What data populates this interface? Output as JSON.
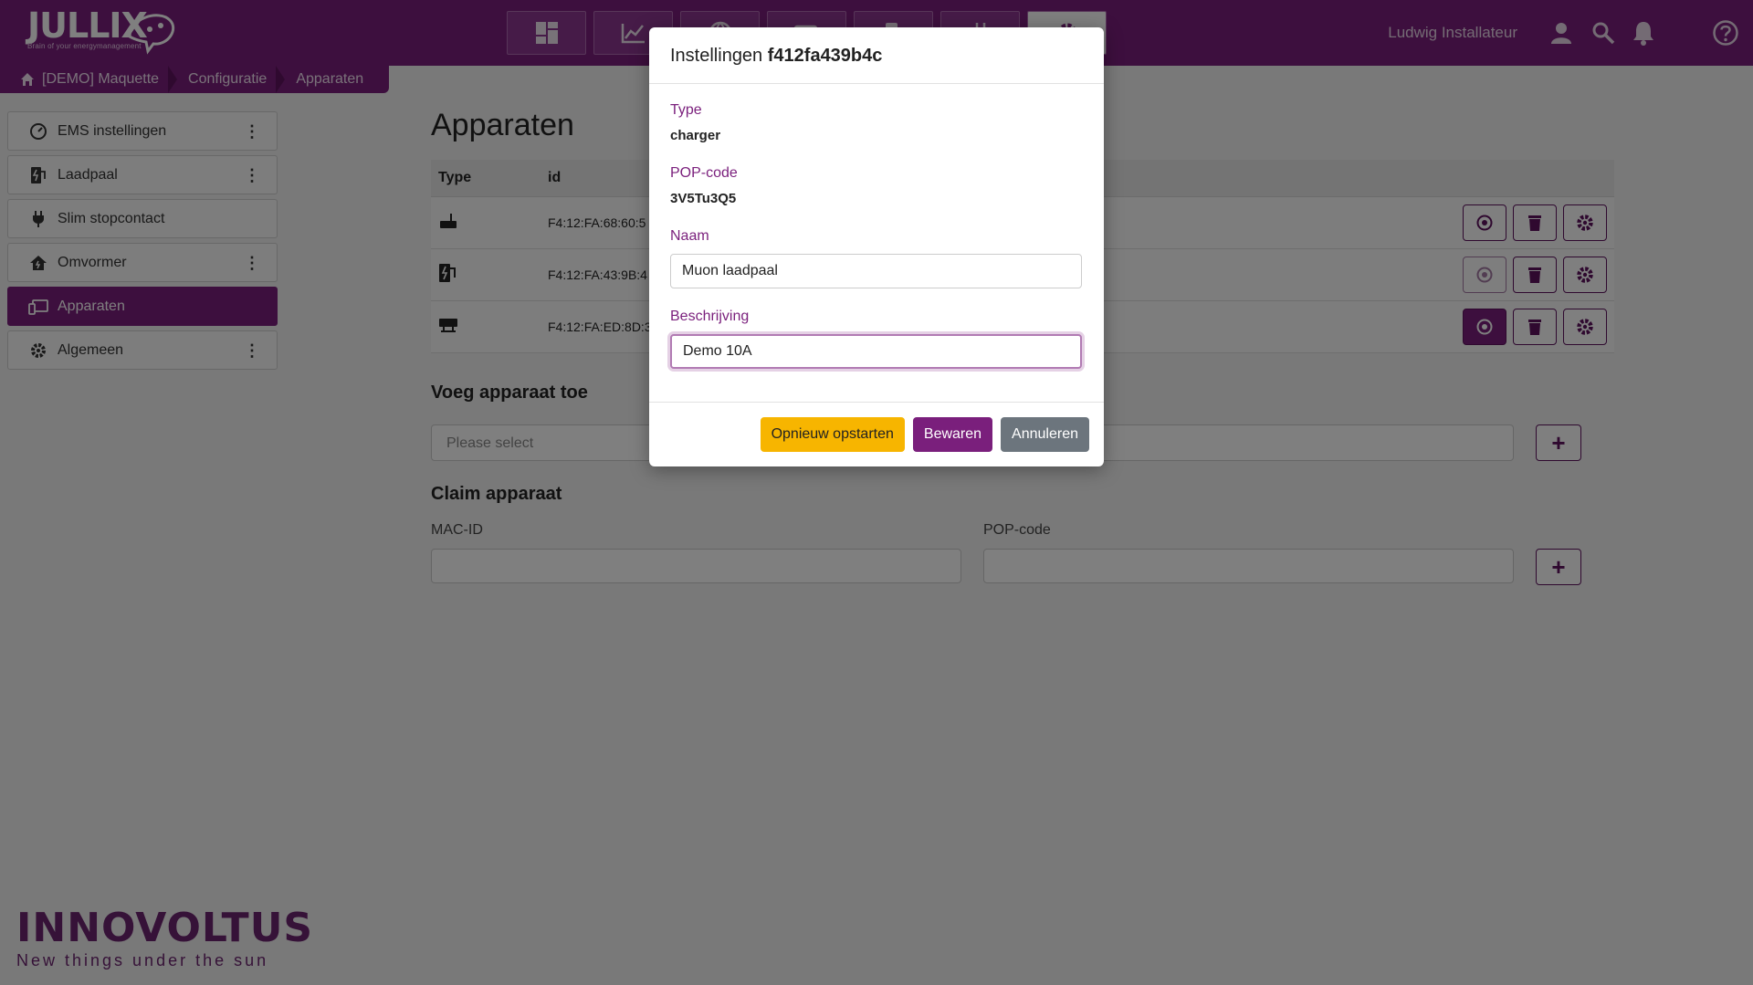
{
  "header": {
    "logo_text": "JULLIX",
    "logo_tagline": "Brain of your energymanagement",
    "user_name": "Ludwig Installateur",
    "nav_tabs": [
      {
        "icon": "dashboard-icon"
      },
      {
        "icon": "chart-icon"
      },
      {
        "icon": "globe-icon"
      },
      {
        "icon": "battery-icon"
      },
      {
        "icon": "charger-icon"
      },
      {
        "icon": "plug-icon"
      },
      {
        "icon": "gear-icon",
        "active": true
      }
    ]
  },
  "breadcrumb": {
    "items": [
      "[DEMO] Maquette",
      "Configuratie",
      "Apparaten"
    ]
  },
  "sidebar": {
    "items": [
      {
        "label": "EMS instellingen",
        "icon": "gauge-icon",
        "has_menu": true
      },
      {
        "label": "Laadpaal",
        "icon": "charger-icon",
        "has_menu": true
      },
      {
        "label": "Slim stopcontact",
        "icon": "plug-icon",
        "has_menu": false
      },
      {
        "label": "Omvormer",
        "icon": "house-icon",
        "has_menu": true
      },
      {
        "label": "Apparaten",
        "icon": "devices-icon",
        "has_menu": false,
        "active": true
      },
      {
        "label": "Algemeen",
        "icon": "gear-icon",
        "has_menu": true
      }
    ]
  },
  "main": {
    "title": "Apparaten",
    "table": {
      "headers": [
        "Type",
        "id"
      ],
      "rows": [
        {
          "type_icon": "router-icon",
          "id": "F4:12:FA:68:60:5"
        },
        {
          "type_icon": "charger-icon",
          "id": "F4:12:FA:43:9B:4"
        },
        {
          "type_icon": "meter-icon",
          "id": "F4:12:FA:ED:8D:3"
        }
      ]
    },
    "add_device": {
      "heading": "Voeg apparaat toe",
      "select_placeholder": "Please select",
      "add_symbol": "+"
    },
    "claim_device": {
      "heading": "Claim apparaat",
      "mac_label": "MAC-ID",
      "pop_label": "POP-code",
      "add_symbol": "+"
    }
  },
  "brand": {
    "name": "INNOVOLTUS",
    "slogan": "New things under the sun"
  },
  "modal": {
    "title_prefix": "Instellingen",
    "title_id": "f412fa439b4c",
    "type_label": "Type",
    "type_value": "charger",
    "pop_label": "POP-code",
    "pop_value": "3V5Tu3Q5",
    "name_label": "Naam",
    "name_value": "Muon laadpaal",
    "desc_label": "Beschrijving",
    "desc_value": "Demo 10A",
    "restart_label": "Opnieuw opstarten",
    "save_label": "Bewaren",
    "cancel_label": "Annuleren"
  },
  "colors": {
    "brand_purple": "#7a1f7c",
    "warn_yellow": "#f7b500",
    "secondary_gray": "#6c757d"
  }
}
